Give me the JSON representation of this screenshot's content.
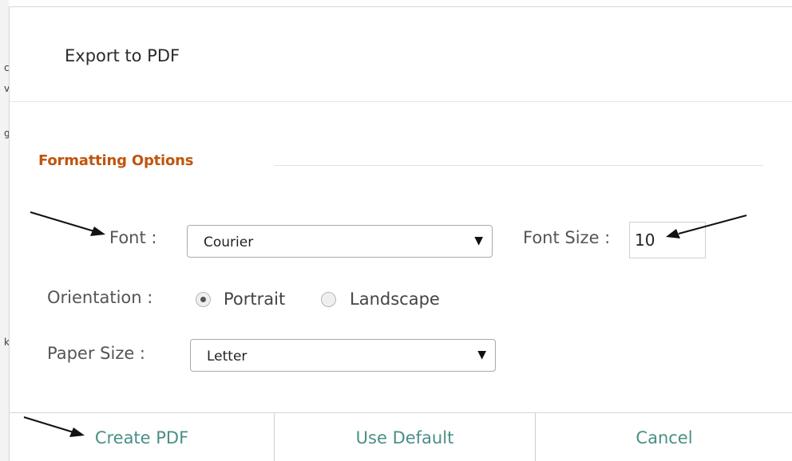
{
  "dialog": {
    "title": "Export to PDF"
  },
  "formatting": {
    "section_title": "Formatting Options",
    "font_label": "Font :",
    "font_value": "Courier",
    "font_size_label": "Font Size :",
    "font_size_value": "10",
    "orientation_label": "Orientation :",
    "orientation_options": [
      "Portrait",
      "Landscape"
    ],
    "orientation_selected": "Portrait",
    "paper_size_label": "Paper Size :",
    "paper_size_value": "Letter"
  },
  "footer": {
    "create_label": "Create PDF",
    "default_label": "Use Default",
    "cancel_label": "Cancel"
  },
  "background_page": {
    "glyphs": [
      "c",
      "v",
      "g",
      "k"
    ]
  },
  "colors": {
    "section_title": "#c0550d",
    "footer_button_text": "#4a8f86"
  }
}
